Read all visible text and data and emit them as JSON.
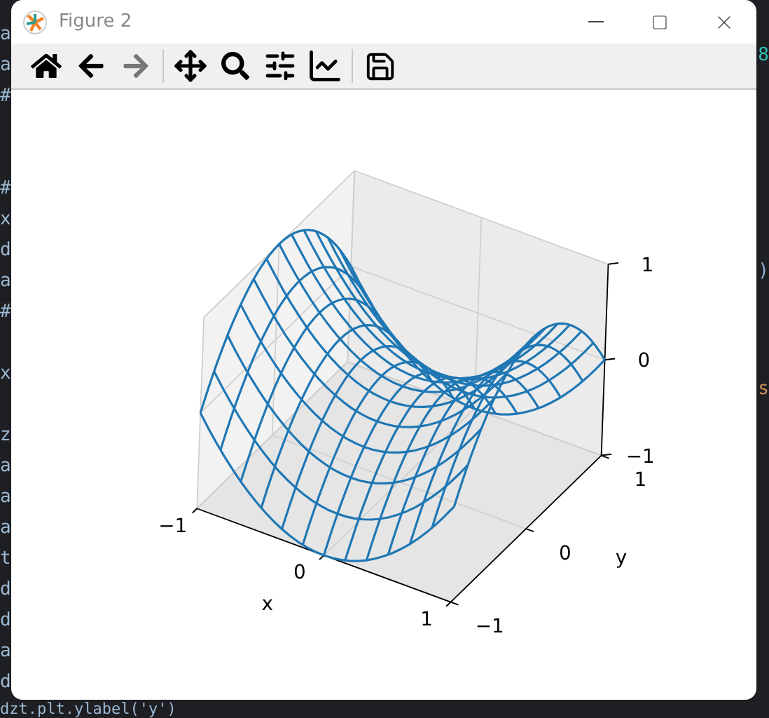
{
  "editor_background": {
    "left_blocks": [
      [
        "a",
        "a",
        "#"
      ],
      [
        "#",
        "x",
        "d",
        "a",
        "#"
      ],
      [
        "x"
      ],
      [
        "z",
        "a",
        "a",
        "a",
        "t",
        "d",
        "d",
        "a",
        "d"
      ]
    ],
    "bottom_line": "dzt.plt.ylabel('y')",
    "right_fragments": [
      "8",
      ")",
      "s"
    ]
  },
  "window": {
    "title": "Figure 2"
  },
  "toolbar": [
    {
      "kind": "home",
      "disabled": false
    },
    {
      "kind": "back",
      "disabled": false
    },
    {
      "kind": "forward",
      "disabled": true
    },
    {
      "kind": "separator"
    },
    {
      "kind": "pan",
      "disabled": false
    },
    {
      "kind": "zoom",
      "disabled": false
    },
    {
      "kind": "subplots",
      "disabled": false
    },
    {
      "kind": "axes",
      "disabled": false
    },
    {
      "kind": "separator"
    },
    {
      "kind": "save",
      "disabled": false
    }
  ],
  "plot": {
    "x_ticks": [
      "−1",
      "0",
      "1"
    ],
    "y_ticks": [
      "−1",
      "0",
      "1"
    ],
    "z_ticks": [
      "1",
      "0",
      "−1"
    ],
    "xlabel": "x",
    "ylabel": "y"
  }
}
